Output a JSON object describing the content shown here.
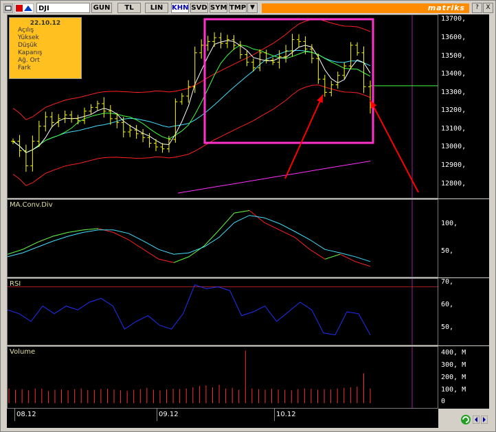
{
  "toolbar": {
    "symbol": "DJI",
    "buttons": [
      "GUN",
      "TL",
      "LIN",
      "KHN",
      "SVD",
      "SYM",
      "TMP"
    ],
    "active_button": "KHN",
    "brand": "matriks",
    "menu_arrow": "▼",
    "help_label": "?",
    "close_label": "X"
  },
  "info_box": {
    "date": "22.10.12",
    "rows": [
      "Açılış",
      "Yüksek",
      "Düşük",
      "Kapanış",
      "Ağ. Ort",
      "Fark"
    ]
  },
  "panels": {
    "price": {
      "axis": [
        "13700,",
        "13600,",
        "13500,",
        "13400,",
        "13300,",
        "13200,",
        "13100,",
        "13000,",
        "12900,",
        "12800,"
      ]
    },
    "macd": {
      "title": "MA.Conv.Div",
      "axis": [
        "100,",
        "50,"
      ]
    },
    "rsi": {
      "title": "RSI",
      "axis": [
        "70,",
        "60,",
        "50,"
      ]
    },
    "volume": {
      "title": "Volume",
      "axis": [
        "400, M",
        "300, M",
        "200, M",
        "100, M",
        "0"
      ]
    }
  },
  "dates": [
    "08.12",
    "09.12",
    "10.12"
  ],
  "colors": {
    "background": "#000000",
    "price_bars": "#ffff00",
    "upper_band": "#ff2020",
    "ma_fast": "#ffffff",
    "ma_mid": "#40ff40",
    "ma_slow": "#40e0ff",
    "long_ma": "#ff30ff",
    "highlight_box": "#ff33cc",
    "arrows": "#ff0000",
    "rsi_line": "#2030ff",
    "volume_bars": "#ff3030"
  },
  "chart_data": [
    {
      "type": "bar",
      "title": "",
      "yticks": [
        13700,
        13600,
        13500,
        13400,
        13300,
        13200,
        13100,
        13000,
        12900,
        12800
      ],
      "ylim": [
        12750,
        13720
      ],
      "xticks": [
        "08.12",
        "09.12",
        "10.12"
      ],
      "close_series": [
        13050,
        13000,
        12920,
        13050,
        13130,
        13180,
        13150,
        13170,
        13190,
        13170,
        13160,
        13210,
        13230,
        13250,
        13210,
        13170,
        13150,
        13100,
        13110,
        13090,
        13070,
        13040,
        13020,
        13010,
        13060,
        13260,
        13290,
        13340,
        13520,
        13560,
        13580,
        13600,
        13570,
        13590,
        13560,
        13510,
        13470,
        13440,
        13520,
        13480,
        13470,
        13500,
        13530,
        13590,
        13580,
        13540,
        13490,
        13380,
        13310,
        13350,
        13400,
        13450,
        13560,
        13520,
        13340,
        13230
      ],
      "annotations": [
        "highlight box around sept-oct peak",
        "arrow to 13310 low",
        "arrow to last bar 13230"
      ],
      "reference_level": 13345
    },
    {
      "type": "line",
      "title": "MA.Conv.Div",
      "yticks": [
        100,
        50
      ],
      "series": [
        {
          "values": [
            45,
            55,
            70,
            82,
            90,
            95,
            98,
            90,
            75,
            55,
            35,
            28,
            40,
            62,
            95,
            130,
            135,
            110,
            95,
            80,
            55,
            35,
            45,
            30,
            20
          ]
        },
        {
          "values": [
            40,
            48,
            60,
            72,
            82,
            90,
            95,
            95,
            88,
            72,
            55,
            45,
            48,
            60,
            80,
            110,
            125,
            120,
            108,
            92,
            75,
            55,
            48,
            40,
            30
          ]
        }
      ]
    },
    {
      "type": "line",
      "title": "RSI",
      "yticks": [
        70,
        60,
        50
      ],
      "values": [
        58,
        56,
        52,
        60,
        56,
        60,
        58,
        62,
        64,
        60,
        48,
        52,
        55,
        50,
        48,
        56,
        71,
        69,
        70,
        68,
        55,
        57,
        60,
        52,
        57,
        62,
        58,
        46,
        45,
        57,
        56,
        45
      ],
      "reference_line": 70
    },
    {
      "type": "bar",
      "title": "Volume",
      "yticks": [
        "400, M",
        "300, M",
        "200, M",
        "100, M",
        "0"
      ],
      "values": [
        120,
        110,
        115,
        105,
        120,
        118,
        100,
        110,
        112,
        105,
        115,
        120,
        108,
        110,
        115,
        118,
        112,
        105,
        100,
        110,
        115,
        125,
        110,
        105,
        112,
        118,
        115,
        120,
        130,
        140,
        145,
        130,
        150,
        120,
        125,
        110,
        430,
        120,
        115,
        110,
        118,
        112,
        110,
        105,
        115,
        120,
        118,
        110,
        115,
        112,
        120,
        125,
        130,
        135,
        245,
        120
      ]
    }
  ]
}
